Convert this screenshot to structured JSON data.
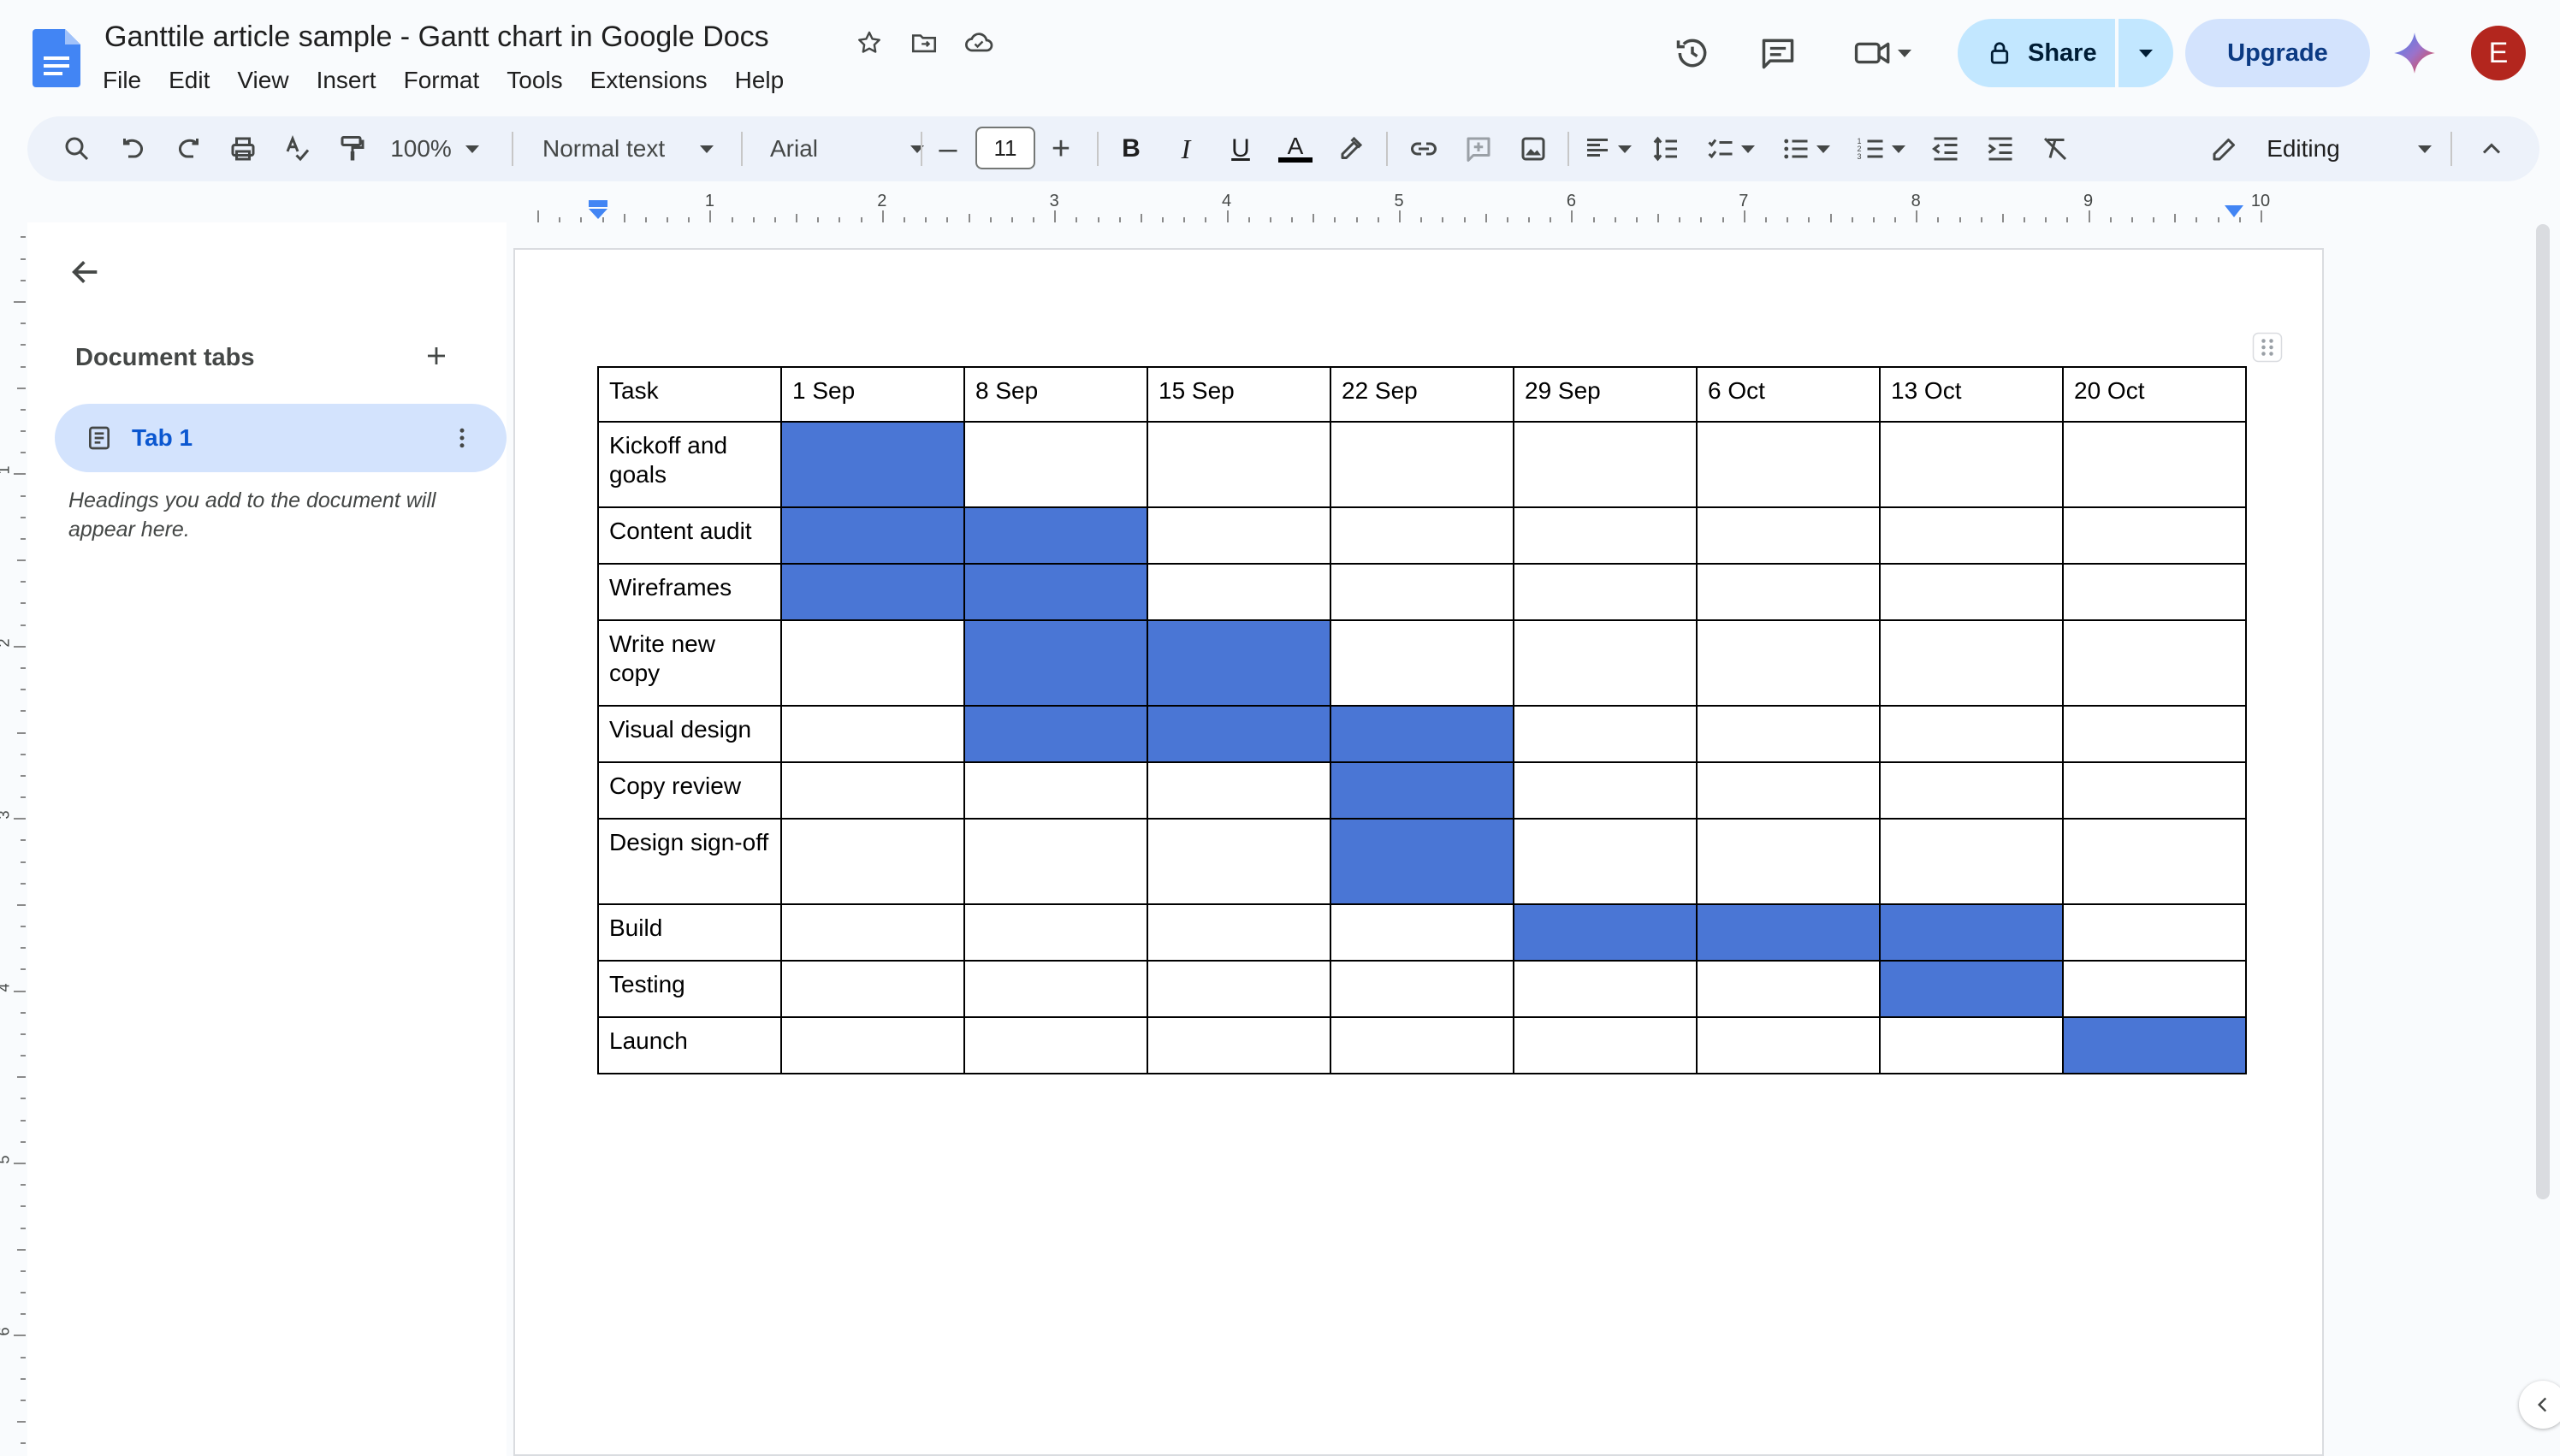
{
  "app": {
    "doc_title": "Ganttile article sample - Gantt chart in Google Docs",
    "menus": [
      "File",
      "Edit",
      "View",
      "Insert",
      "Format",
      "Tools",
      "Extensions",
      "Help"
    ],
    "share_label": "Share",
    "upgrade_label": "Upgrade",
    "avatar_initial": "E"
  },
  "toolbar": {
    "zoom": "100%",
    "style": "Normal text",
    "font": "Arial",
    "font_size": "11",
    "mode": "Editing"
  },
  "ruler": {
    "numbers": [
      "1",
      "2",
      "3",
      "4",
      "5",
      "6",
      "7",
      "8",
      "9",
      "10"
    ]
  },
  "sidebar": {
    "heading": "Document tabs",
    "tab_label": "Tab 1",
    "hint": "Headings you add to the document will appear here."
  },
  "gantt": {
    "header": [
      "Task",
      "1 Sep",
      "8 Sep",
      "15 Sep",
      "22 Sep",
      "29 Sep",
      "6 Oct",
      "13 Oct",
      "20 Oct"
    ],
    "fill_color": "#4a76d5",
    "rows": [
      {
        "task": "Kickoff and goals",
        "filled": [
          0
        ]
      },
      {
        "task": "Content audit",
        "filled": [
          0,
          1
        ]
      },
      {
        "task": "Wireframes",
        "filled": [
          0,
          1
        ]
      },
      {
        "task": "Write new copy",
        "filled": [
          1,
          2
        ]
      },
      {
        "task": "Visual design",
        "filled": [
          1,
          2,
          3
        ]
      },
      {
        "task": "Copy review",
        "filled": [
          3
        ]
      },
      {
        "task": "Design sign-off",
        "filled": [
          3
        ]
      },
      {
        "task": "Build",
        "filled": [
          4,
          5,
          6
        ]
      },
      {
        "task": "Testing",
        "filled": [
          6
        ]
      },
      {
        "task": "Launch",
        "filled": [
          7
        ]
      }
    ]
  }
}
